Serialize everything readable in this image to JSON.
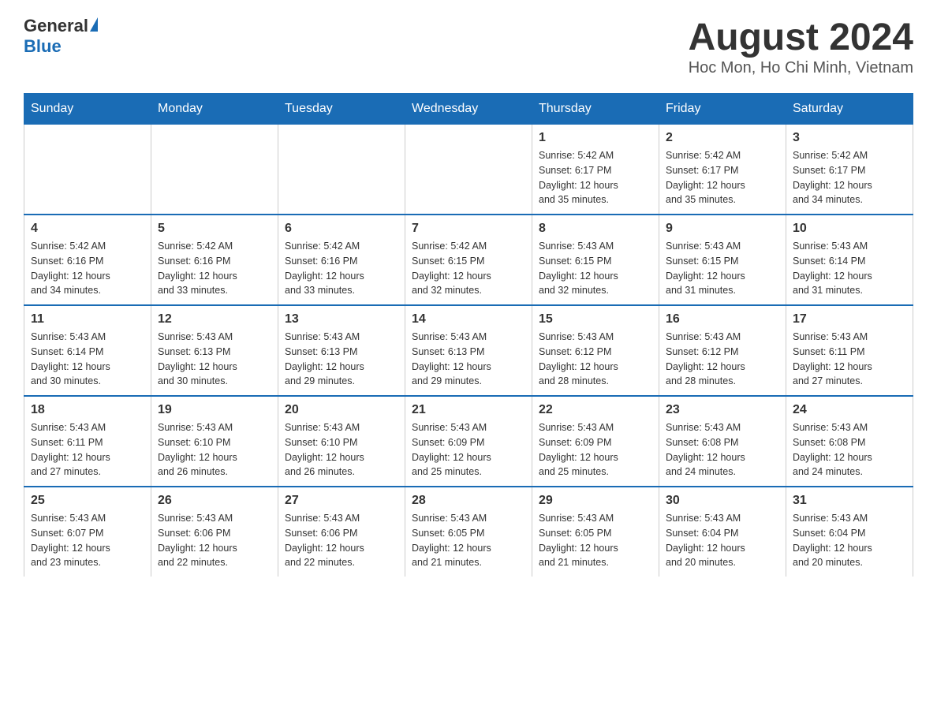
{
  "header": {
    "logo_general": "General",
    "logo_blue": "Blue",
    "month_year": "August 2024",
    "location": "Hoc Mon, Ho Chi Minh, Vietnam"
  },
  "weekdays": [
    "Sunday",
    "Monday",
    "Tuesday",
    "Wednesday",
    "Thursday",
    "Friday",
    "Saturday"
  ],
  "weeks": [
    {
      "days": [
        {
          "num": "",
          "info": ""
        },
        {
          "num": "",
          "info": ""
        },
        {
          "num": "",
          "info": ""
        },
        {
          "num": "",
          "info": ""
        },
        {
          "num": "1",
          "info": "Sunrise: 5:42 AM\nSunset: 6:17 PM\nDaylight: 12 hours\nand 35 minutes."
        },
        {
          "num": "2",
          "info": "Sunrise: 5:42 AM\nSunset: 6:17 PM\nDaylight: 12 hours\nand 35 minutes."
        },
        {
          "num": "3",
          "info": "Sunrise: 5:42 AM\nSunset: 6:17 PM\nDaylight: 12 hours\nand 34 minutes."
        }
      ]
    },
    {
      "days": [
        {
          "num": "4",
          "info": "Sunrise: 5:42 AM\nSunset: 6:16 PM\nDaylight: 12 hours\nand 34 minutes."
        },
        {
          "num": "5",
          "info": "Sunrise: 5:42 AM\nSunset: 6:16 PM\nDaylight: 12 hours\nand 33 minutes."
        },
        {
          "num": "6",
          "info": "Sunrise: 5:42 AM\nSunset: 6:16 PM\nDaylight: 12 hours\nand 33 minutes."
        },
        {
          "num": "7",
          "info": "Sunrise: 5:42 AM\nSunset: 6:15 PM\nDaylight: 12 hours\nand 32 minutes."
        },
        {
          "num": "8",
          "info": "Sunrise: 5:43 AM\nSunset: 6:15 PM\nDaylight: 12 hours\nand 32 minutes."
        },
        {
          "num": "9",
          "info": "Sunrise: 5:43 AM\nSunset: 6:15 PM\nDaylight: 12 hours\nand 31 minutes."
        },
        {
          "num": "10",
          "info": "Sunrise: 5:43 AM\nSunset: 6:14 PM\nDaylight: 12 hours\nand 31 minutes."
        }
      ]
    },
    {
      "days": [
        {
          "num": "11",
          "info": "Sunrise: 5:43 AM\nSunset: 6:14 PM\nDaylight: 12 hours\nand 30 minutes."
        },
        {
          "num": "12",
          "info": "Sunrise: 5:43 AM\nSunset: 6:13 PM\nDaylight: 12 hours\nand 30 minutes."
        },
        {
          "num": "13",
          "info": "Sunrise: 5:43 AM\nSunset: 6:13 PM\nDaylight: 12 hours\nand 29 minutes."
        },
        {
          "num": "14",
          "info": "Sunrise: 5:43 AM\nSunset: 6:13 PM\nDaylight: 12 hours\nand 29 minutes."
        },
        {
          "num": "15",
          "info": "Sunrise: 5:43 AM\nSunset: 6:12 PM\nDaylight: 12 hours\nand 28 minutes."
        },
        {
          "num": "16",
          "info": "Sunrise: 5:43 AM\nSunset: 6:12 PM\nDaylight: 12 hours\nand 28 minutes."
        },
        {
          "num": "17",
          "info": "Sunrise: 5:43 AM\nSunset: 6:11 PM\nDaylight: 12 hours\nand 27 minutes."
        }
      ]
    },
    {
      "days": [
        {
          "num": "18",
          "info": "Sunrise: 5:43 AM\nSunset: 6:11 PM\nDaylight: 12 hours\nand 27 minutes."
        },
        {
          "num": "19",
          "info": "Sunrise: 5:43 AM\nSunset: 6:10 PM\nDaylight: 12 hours\nand 26 minutes."
        },
        {
          "num": "20",
          "info": "Sunrise: 5:43 AM\nSunset: 6:10 PM\nDaylight: 12 hours\nand 26 minutes."
        },
        {
          "num": "21",
          "info": "Sunrise: 5:43 AM\nSunset: 6:09 PM\nDaylight: 12 hours\nand 25 minutes."
        },
        {
          "num": "22",
          "info": "Sunrise: 5:43 AM\nSunset: 6:09 PM\nDaylight: 12 hours\nand 25 minutes."
        },
        {
          "num": "23",
          "info": "Sunrise: 5:43 AM\nSunset: 6:08 PM\nDaylight: 12 hours\nand 24 minutes."
        },
        {
          "num": "24",
          "info": "Sunrise: 5:43 AM\nSunset: 6:08 PM\nDaylight: 12 hours\nand 24 minutes."
        }
      ]
    },
    {
      "days": [
        {
          "num": "25",
          "info": "Sunrise: 5:43 AM\nSunset: 6:07 PM\nDaylight: 12 hours\nand 23 minutes."
        },
        {
          "num": "26",
          "info": "Sunrise: 5:43 AM\nSunset: 6:06 PM\nDaylight: 12 hours\nand 22 minutes."
        },
        {
          "num": "27",
          "info": "Sunrise: 5:43 AM\nSunset: 6:06 PM\nDaylight: 12 hours\nand 22 minutes."
        },
        {
          "num": "28",
          "info": "Sunrise: 5:43 AM\nSunset: 6:05 PM\nDaylight: 12 hours\nand 21 minutes."
        },
        {
          "num": "29",
          "info": "Sunrise: 5:43 AM\nSunset: 6:05 PM\nDaylight: 12 hours\nand 21 minutes."
        },
        {
          "num": "30",
          "info": "Sunrise: 5:43 AM\nSunset: 6:04 PM\nDaylight: 12 hours\nand 20 minutes."
        },
        {
          "num": "31",
          "info": "Sunrise: 5:43 AM\nSunset: 6:04 PM\nDaylight: 12 hours\nand 20 minutes."
        }
      ]
    }
  ]
}
